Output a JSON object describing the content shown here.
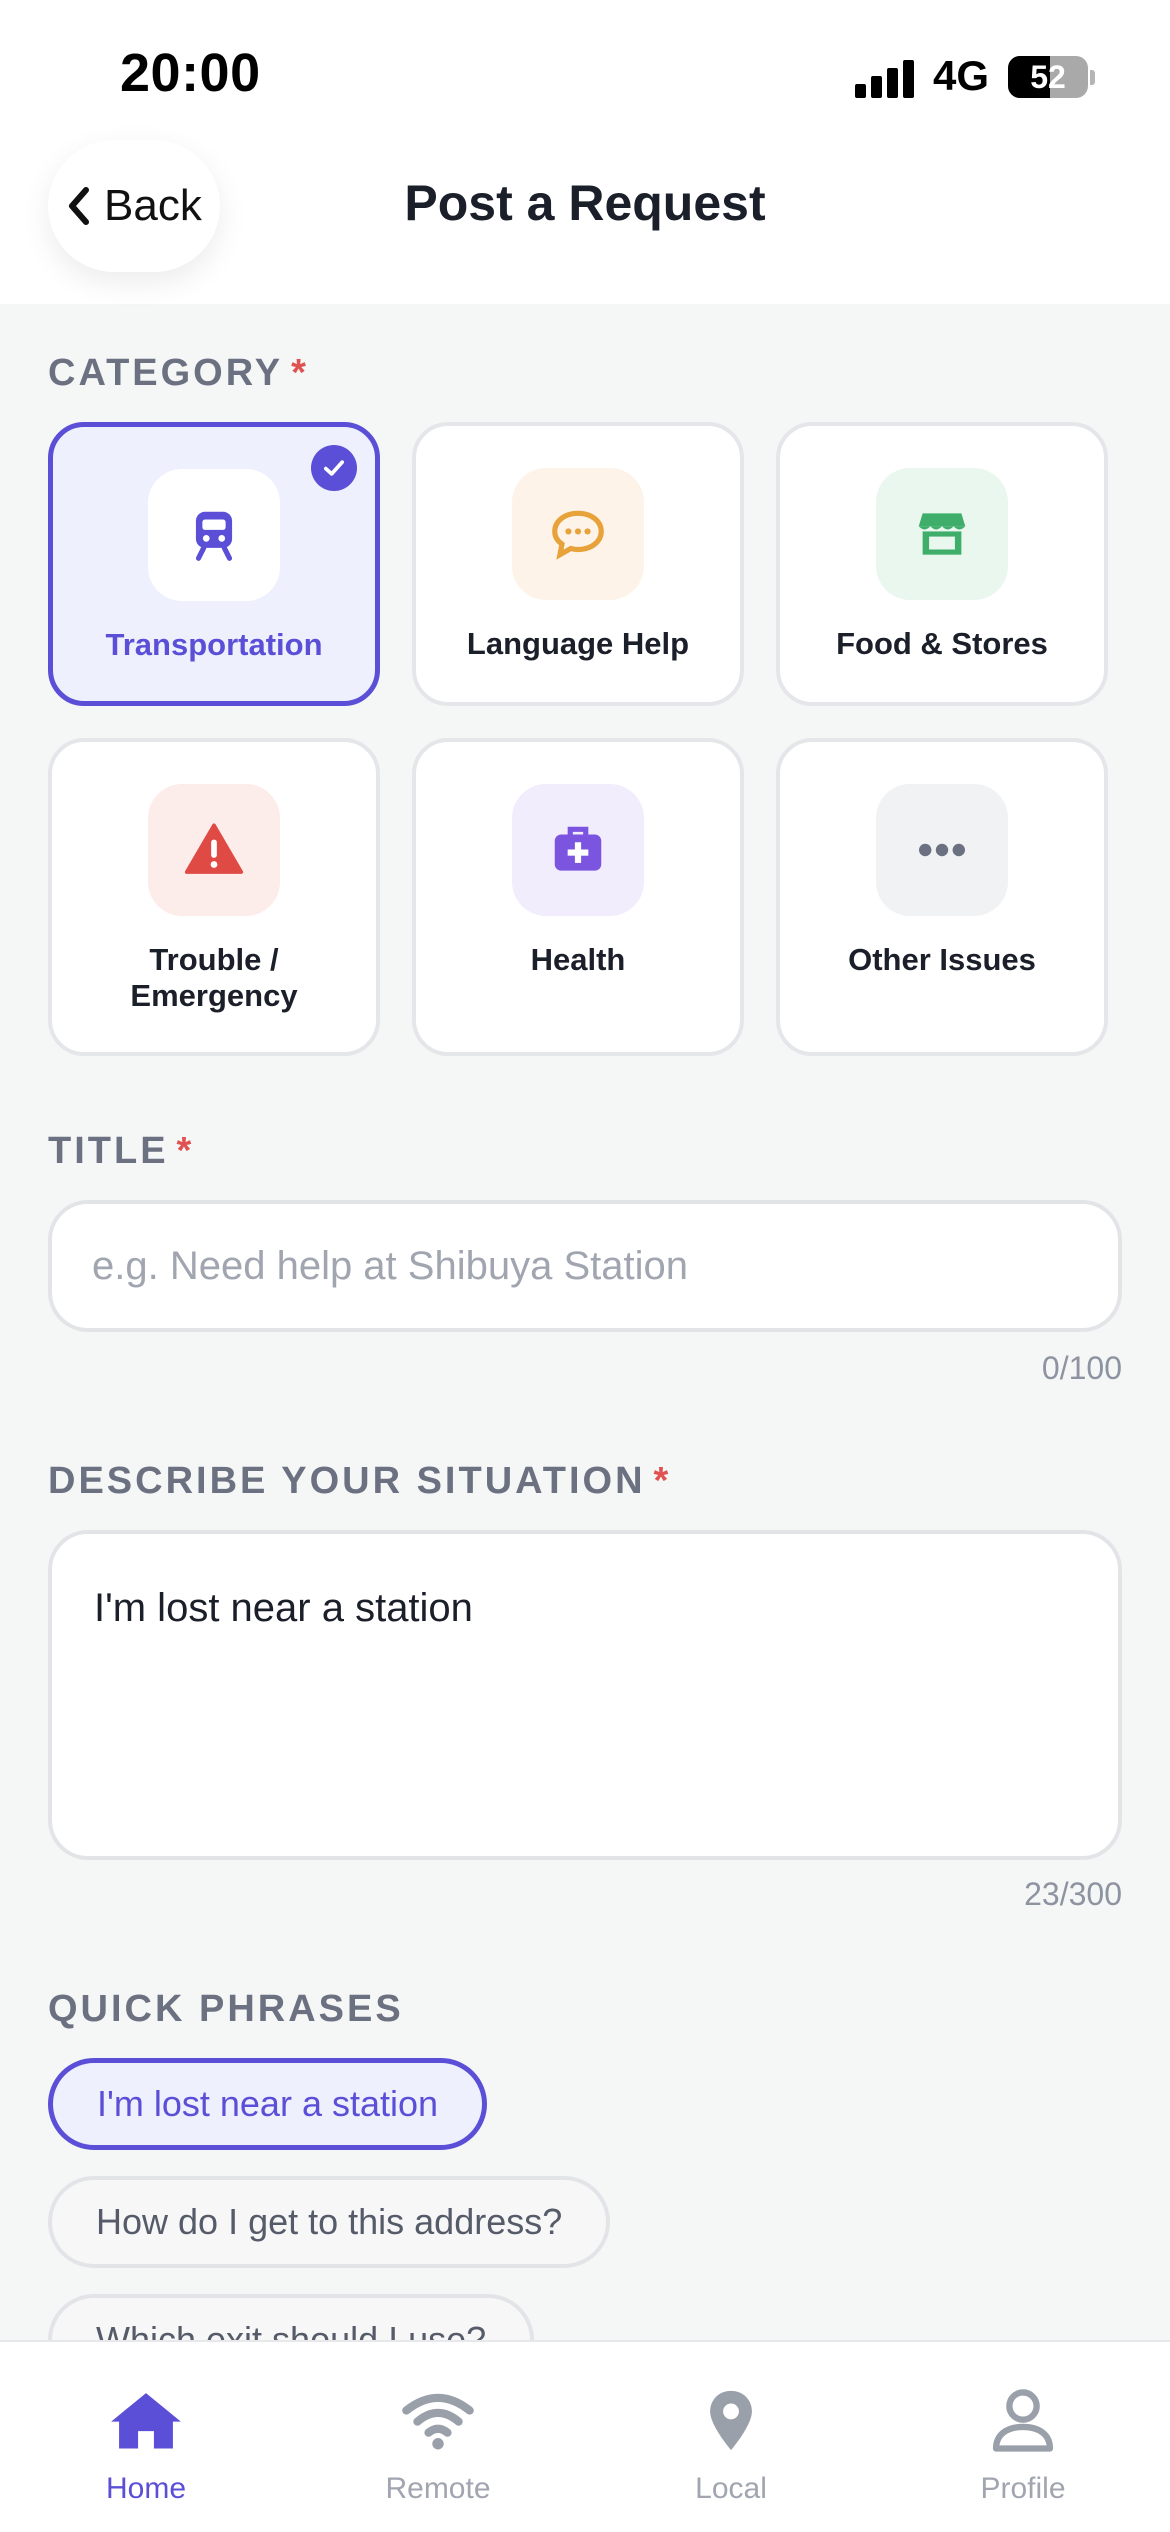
{
  "status_bar": {
    "time": "20:00",
    "network": "4G",
    "battery": "52"
  },
  "header": {
    "back_label": "Back",
    "title": "Post a Request"
  },
  "category_section": {
    "label": "CATEGORY",
    "required_mark": "*",
    "items": [
      {
        "label": "Transportation",
        "icon": "train-icon",
        "selected": true
      },
      {
        "label": "Language Help",
        "icon": "chat-bubble-icon",
        "selected": false
      },
      {
        "label": "Food & Stores",
        "icon": "store-icon",
        "selected": false
      },
      {
        "label_line1": "Trouble /",
        "label_line2": "Emergency",
        "icon": "warning-icon",
        "selected": false
      },
      {
        "label": "Health",
        "icon": "medical-kit-icon",
        "selected": false
      },
      {
        "label": "Other Issues",
        "icon": "more-dots-icon",
        "selected": false
      }
    ]
  },
  "title_section": {
    "label": "TITLE",
    "required_mark": "*",
    "placeholder": "e.g. Need help at Shibuya Station",
    "value": "",
    "counter": "0/100"
  },
  "description_section": {
    "label": "DESCRIBE YOUR SITUATION",
    "required_mark": "*",
    "value": "I'm lost near a station",
    "counter": "23/300"
  },
  "quick_phrases": {
    "label": "QUICK PHRASES",
    "items": [
      {
        "text": "I'm lost near a station",
        "active": true
      },
      {
        "text": "How do I get to this address?",
        "active": false
      },
      {
        "text": "Which exit should I use?",
        "active": false
      }
    ]
  },
  "tab_bar": {
    "items": [
      {
        "label": "Home",
        "active": true
      },
      {
        "label": "Remote",
        "active": false
      },
      {
        "label": "Local",
        "active": false
      },
      {
        "label": "Profile",
        "active": false
      }
    ]
  },
  "colors": {
    "accent": "#5a4fd6",
    "required": "#e05252",
    "language": "#e8a23a",
    "food": "#3fae6a",
    "trouble": "#e04a45",
    "health": "#7b55e0",
    "other": "#6b7180"
  }
}
